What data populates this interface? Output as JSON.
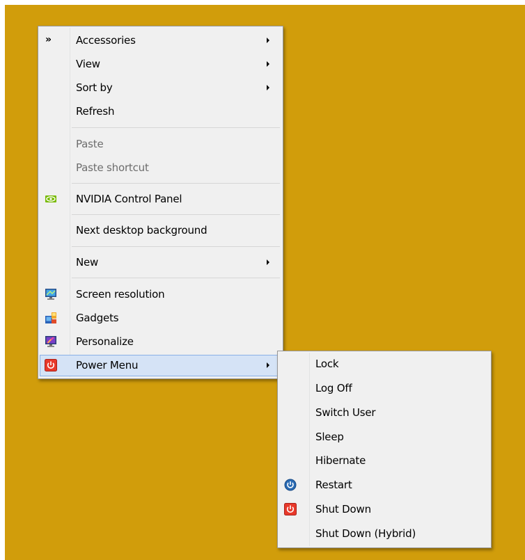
{
  "context_menu": {
    "overflow_glyph": "»",
    "accessories": "Accessories",
    "view": "View",
    "sort_by": "Sort by",
    "refresh": "Refresh",
    "paste": "Paste",
    "paste_shortcut": "Paste shortcut",
    "nvidia": "NVIDIA Control Panel",
    "next_background": "Next desktop background",
    "new": "New",
    "screen_resolution": "Screen resolution",
    "gadgets": "Gadgets",
    "personalize": "Personalize",
    "power_menu": "Power Menu"
  },
  "power_submenu": {
    "lock": "Lock",
    "log_off": "Log Off",
    "switch_user": "Switch User",
    "sleep": "Sleep",
    "hibernate": "Hibernate",
    "restart": "Restart",
    "shut_down": "Shut Down",
    "shut_down_hybrid": "Shut Down (Hybrid)"
  },
  "colors": {
    "desktop": "#d19d0b",
    "menu_bg": "#f0f0f0",
    "highlight": "#d5e3f6",
    "power_red": "#e8392a",
    "restart_blue": "#2a6bb3"
  },
  "icons": {
    "overflow": "double-chevron-icon",
    "nvidia": "nvidia-icon",
    "screen_resolution": "monitor-icon",
    "gadgets": "gadgets-icon",
    "personalize": "personalize-icon",
    "power_menu": "power-icon",
    "restart": "restart-icon",
    "shut_down": "power-icon"
  }
}
